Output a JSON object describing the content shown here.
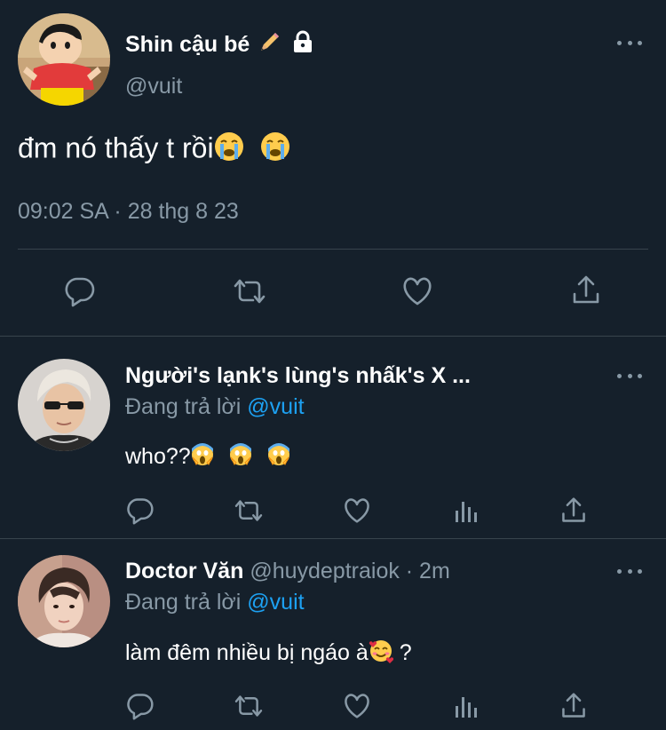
{
  "main_tweet": {
    "display_name": "Shin cậu bé",
    "handle": "@vuit",
    "text": "đm nó thấy t rồi",
    "time": "09:02 SA",
    "separator": " · ",
    "date": "28 thg 8 23"
  },
  "replies": [
    {
      "display_name": "Người's lạnk's lùng's nhấk's X ...",
      "replying_prefix": "Đang trả lời ",
      "replying_to": "@vuit",
      "text": "who??"
    },
    {
      "display_name": "Doctor Văn",
      "handle_time": "@huydeptraiok · 2m",
      "replying_prefix": "Đang trả lời ",
      "replying_to": "@vuit",
      "text": "làm đêm nhiều bị ngáo à",
      "text_suffix": " ?"
    }
  ],
  "colors": {
    "background": "#15202b",
    "secondary_text": "#8899a6",
    "mention": "#1da1f2",
    "divider": "#38444d"
  }
}
